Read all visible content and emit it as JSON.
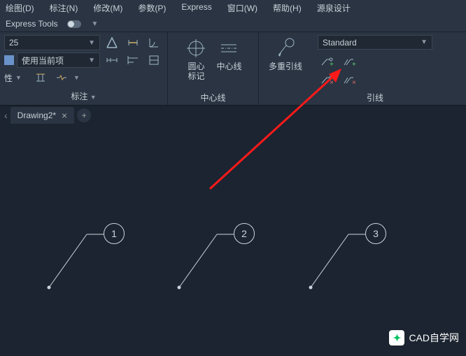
{
  "menu": {
    "draw": "绘图(D)",
    "dim": "标注(N)",
    "modify": "修改(M)",
    "param": "参数(P)",
    "express": "Express",
    "window": "窗口(W)",
    "help": "帮助(H)",
    "yuanquan": "源泉设计"
  },
  "subbar": {
    "express_tools": "Express Tools"
  },
  "dimpanel": {
    "style_value": "25",
    "use_current": "使用当前项",
    "prop_label": "性",
    "panel_label": "标注"
  },
  "center": {
    "mark": "圆心\n标记",
    "cline": "中心线",
    "panel_label": "中心线"
  },
  "leader": {
    "multileader": "多重引线",
    "style": "Standard",
    "panel_label": "引线"
  },
  "tabs": {
    "drawing2": "Drawing2*"
  },
  "balloons": [
    "1",
    "2",
    "3"
  ],
  "watermark": "CAD自学网"
}
